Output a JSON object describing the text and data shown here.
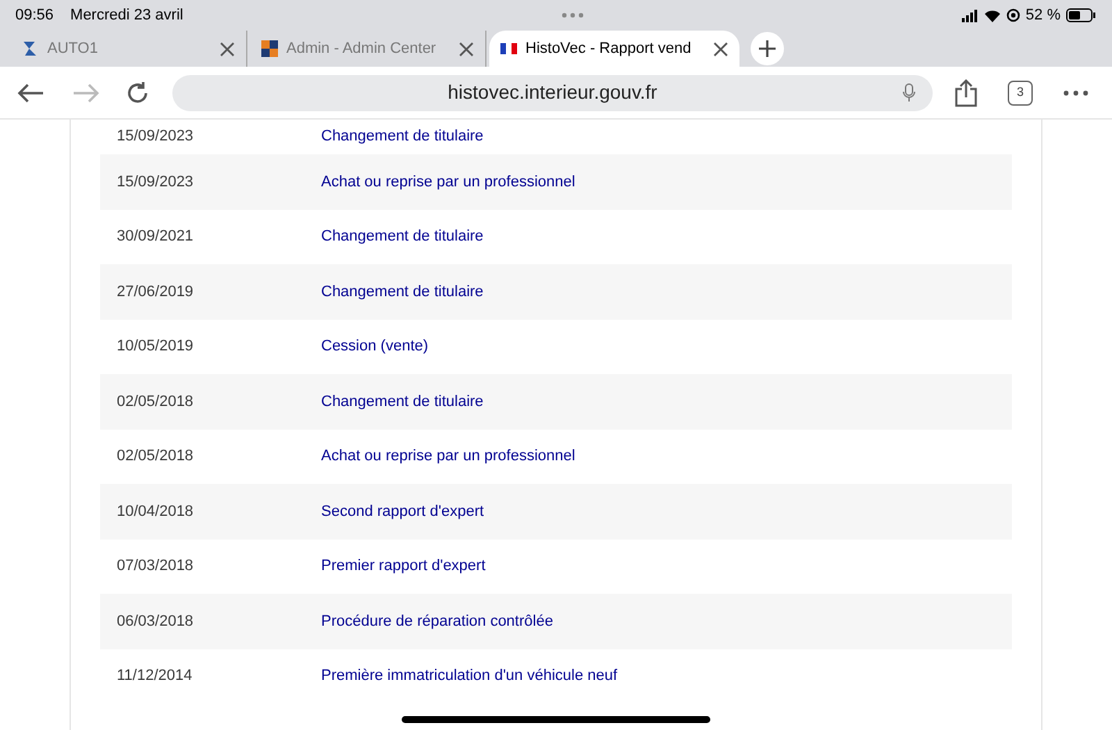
{
  "status_bar": {
    "time": "09:56",
    "date": "Mercredi 23 avril",
    "battery": "52 %"
  },
  "tabs": [
    {
      "label": "AUTO1",
      "selected": false,
      "kind": "auto"
    },
    {
      "label": "Admin - Admin Center",
      "selected": false,
      "kind": "squares"
    },
    {
      "label": "HistoVec - Rapport vend",
      "selected": true,
      "kind": "flag"
    }
  ],
  "toolbar": {
    "url": "histovec.interieur.gouv.fr",
    "tab_count": "3"
  },
  "history": [
    {
      "date": "15/09/2023",
      "event": "Changement de titulaire"
    },
    {
      "date": "15/09/2023",
      "event": "Achat ou reprise par un professionnel"
    },
    {
      "date": "30/09/2021",
      "event": "Changement de titulaire"
    },
    {
      "date": "27/06/2019",
      "event": "Changement de titulaire"
    },
    {
      "date": "10/05/2019",
      "event": "Cession (vente)"
    },
    {
      "date": "02/05/2018",
      "event": "Changement de titulaire"
    },
    {
      "date": "02/05/2018",
      "event": "Achat ou reprise par un professionnel"
    },
    {
      "date": "10/04/2018",
      "event": "Second rapport d'expert"
    },
    {
      "date": "07/03/2018",
      "event": "Premier rapport d'expert"
    },
    {
      "date": "06/03/2018",
      "event": "Procédure de réparation contrôlée"
    },
    {
      "date": "11/12/2014",
      "event": "Première immatriculation d'un véhicule neuf"
    }
  ]
}
